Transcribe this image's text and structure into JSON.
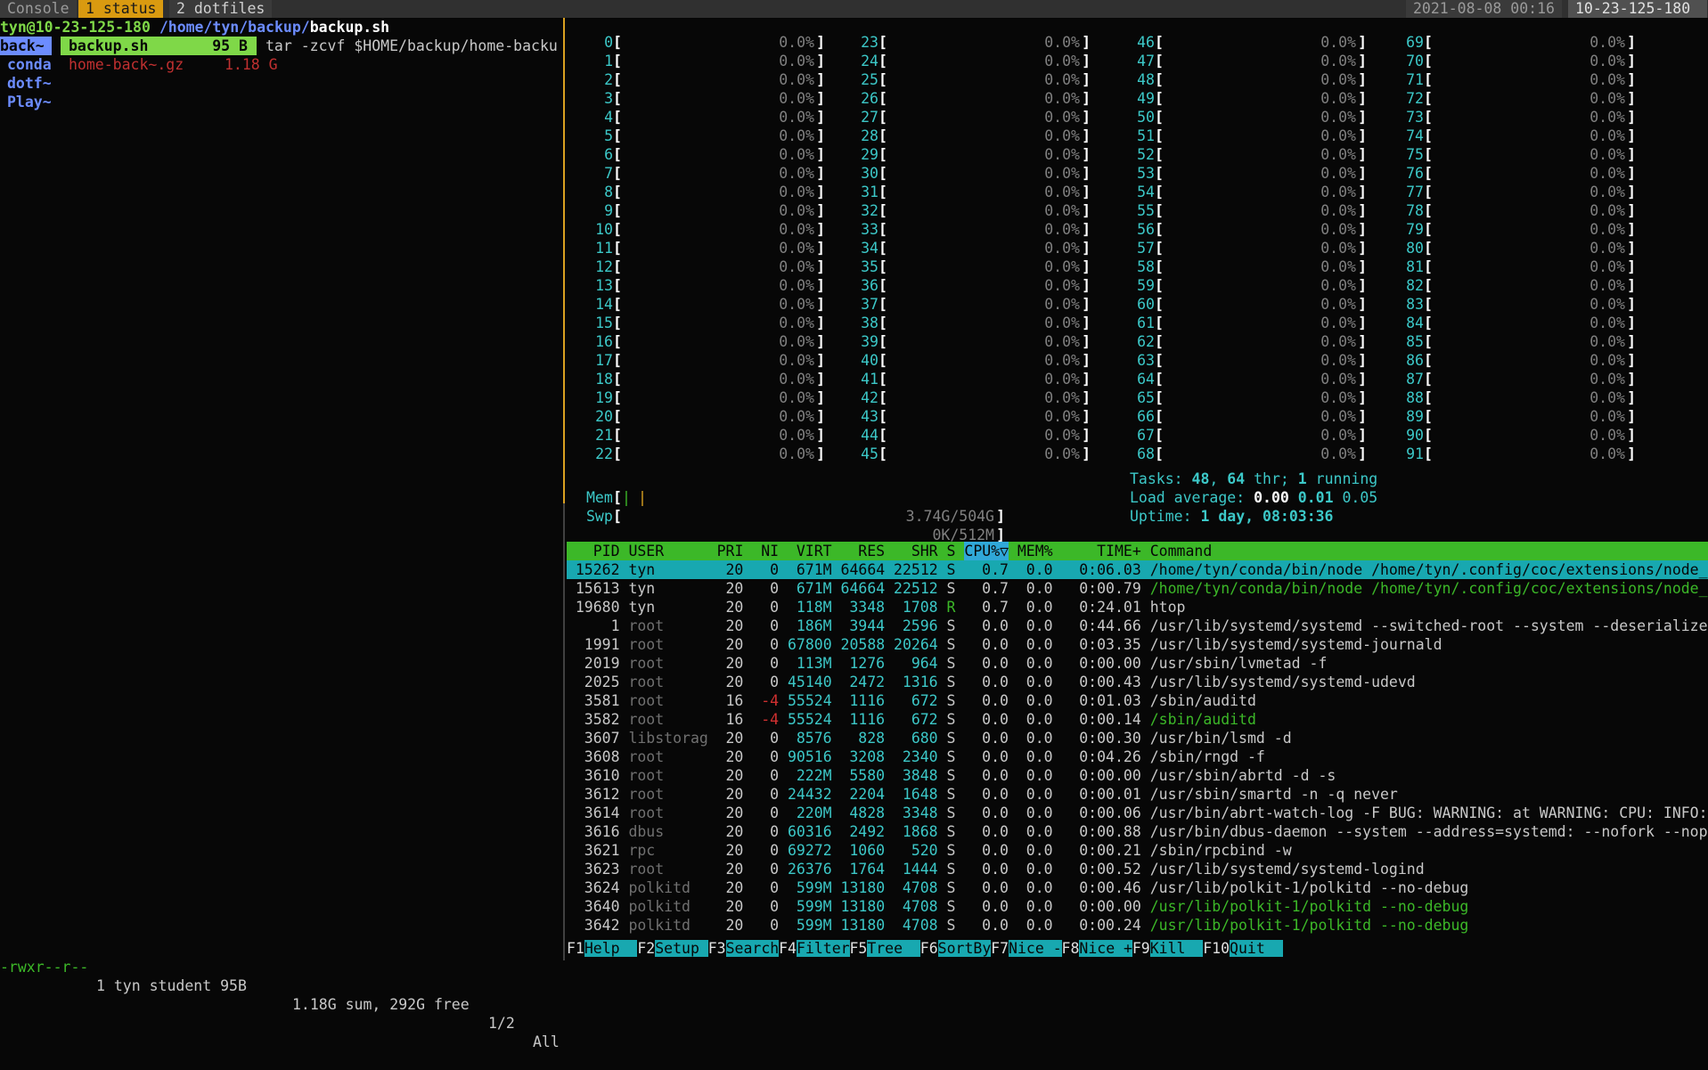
{
  "tmux": {
    "tabs": [
      "Console",
      "1 status",
      "2 dotfiles"
    ],
    "datetime": "2021-08-08 00:16",
    "host": "10-23-125-180"
  },
  "ranger": {
    "path_user": "tyn@10-23-125-180",
    "path_dir": " /home/tyn/backup/",
    "path_file": "backup.sh",
    "parent_entries": [
      "back~",
      "conda",
      "dotf~",
      "Play~"
    ],
    "current_file": "backup.sh",
    "current_size": "95 B",
    "current_extra_name": "home-back~.gz",
    "current_extra_size": "1.18 G",
    "preview": "tar -zcvf $HOME/backup/home-backu",
    "status_perm": "-rwxr--r--",
    "status_owner": "1 tyn student 95B",
    "status_sum": "1.18G sum, 292G free",
    "status_page": "1/2",
    "status_all": "All"
  },
  "htop": {
    "cpus": [
      [
        "0",
        "0.0%"
      ],
      [
        "1",
        "0.0%"
      ],
      [
        "2",
        "0.0%"
      ],
      [
        "3",
        "0.0%"
      ],
      [
        "4",
        "0.0%"
      ],
      [
        "5",
        "0.0%"
      ],
      [
        "6",
        "0.0%"
      ],
      [
        "7",
        "0.0%"
      ],
      [
        "8",
        "0.0%"
      ],
      [
        "9",
        "0.0%"
      ],
      [
        "10",
        "0.0%"
      ],
      [
        "11",
        "0.0%"
      ],
      [
        "12",
        "0.0%"
      ],
      [
        "13",
        "0.0%"
      ],
      [
        "14",
        "0.0%"
      ],
      [
        "15",
        "0.0%"
      ],
      [
        "16",
        "0.0%"
      ],
      [
        "17",
        "0.0%"
      ],
      [
        "18",
        "0.0%"
      ],
      [
        "19",
        "0.0%"
      ],
      [
        "20",
        "0.0%"
      ],
      [
        "21",
        "0.0%"
      ],
      [
        "22",
        "0.0%"
      ],
      [
        "23",
        "0.0%"
      ],
      [
        "24",
        "0.0%"
      ],
      [
        "25",
        "0.0%"
      ],
      [
        "26",
        "0.0%"
      ],
      [
        "27",
        "0.0%"
      ],
      [
        "28",
        "0.0%"
      ],
      [
        "29",
        "0.0%"
      ],
      [
        "30",
        "0.0%"
      ],
      [
        "31",
        "0.0%"
      ],
      [
        "32",
        "0.0%"
      ],
      [
        "33",
        "0.0%"
      ],
      [
        "34",
        "0.0%"
      ],
      [
        "35",
        "0.0%"
      ],
      [
        "36",
        "0.0%"
      ],
      [
        "37",
        "0.0%"
      ],
      [
        "38",
        "0.0%"
      ],
      [
        "39",
        "0.0%"
      ],
      [
        "40",
        "0.0%"
      ],
      [
        "41",
        "0.0%"
      ],
      [
        "42",
        "0.0%"
      ],
      [
        "43",
        "0.0%"
      ],
      [
        "44",
        "0.0%"
      ],
      [
        "45",
        "0.0%"
      ],
      [
        "46",
        "0.0%"
      ],
      [
        "47",
        "0.0%"
      ],
      [
        "48",
        "0.0%"
      ],
      [
        "49",
        "0.0%"
      ],
      [
        "50",
        "0.0%"
      ],
      [
        "51",
        "0.0%"
      ],
      [
        "52",
        "0.0%"
      ],
      [
        "53",
        "0.0%"
      ],
      [
        "54",
        "0.0%"
      ],
      [
        "55",
        "0.0%"
      ],
      [
        "56",
        "0.0%"
      ],
      [
        "57",
        "0.0%"
      ],
      [
        "58",
        "0.0%"
      ],
      [
        "59",
        "0.0%"
      ],
      [
        "60",
        "0.0%"
      ],
      [
        "61",
        "0.0%"
      ],
      [
        "62",
        "0.0%"
      ],
      [
        "63",
        "0.0%"
      ],
      [
        "64",
        "0.0%"
      ],
      [
        "65",
        "0.0%"
      ],
      [
        "66",
        "0.0%"
      ],
      [
        "67",
        "0.0%"
      ],
      [
        "68",
        "0.0%"
      ],
      [
        "69",
        "0.0%"
      ],
      [
        "70",
        "0.0%"
      ],
      [
        "71",
        "0.0%"
      ],
      [
        "72",
        "0.0%"
      ],
      [
        "73",
        "0.0%"
      ],
      [
        "74",
        "0.0%"
      ],
      [
        "75",
        "0.0%"
      ],
      [
        "76",
        "0.0%"
      ],
      [
        "77",
        "0.0%"
      ],
      [
        "78",
        "0.0%"
      ],
      [
        "79",
        "0.0%"
      ],
      [
        "80",
        "0.0%"
      ],
      [
        "81",
        "0.0%"
      ],
      [
        "82",
        "0.0%"
      ],
      [
        "83",
        "0.0%"
      ],
      [
        "84",
        "0.0%"
      ],
      [
        "85",
        "0.0%"
      ],
      [
        "86",
        "0.0%"
      ],
      [
        "87",
        "0.0%"
      ],
      [
        "88",
        "0.0%"
      ],
      [
        "89",
        "0.0%"
      ],
      [
        "90",
        "0.0%"
      ],
      [
        "91",
        "0.0%"
      ]
    ],
    "mem_label": "Mem",
    "mem_value": "3.74G/504G",
    "swp_label": "Swp",
    "swp_value": "0K/512M",
    "tasks_label": "Tasks: ",
    "tasks_count": "48",
    "tasks_sep1": ", ",
    "thr_count": "64",
    "thr_label": " thr; ",
    "running_count": "1",
    "running_label": " running",
    "load_label": "Load average: ",
    "load1": "0.00",
    "load5": "0.01",
    "load15": "0.05",
    "uptime_label": "Uptime: ",
    "uptime_value": "1 day, 08:03:36",
    "columns": [
      "PID",
      "USER",
      "PRI",
      "NI",
      "VIRT",
      "RES",
      "SHR",
      "S",
      "CPU%▽",
      "MEM%",
      "TIME+",
      "Command"
    ],
    "processes": [
      {
        "pid": "15262",
        "user": "tyn",
        "pri": "20",
        "ni": "0",
        "virt": "671M",
        "res": "64664",
        "shr": "22512",
        "s": "S",
        "cpu": "0.7",
        "mem": "0.0",
        "time": "0:06.03",
        "cmd": "/home/tyn/conda/bin/node /home/tyn/.config/coc/extensions/node_m"
      },
      {
        "pid": "15613",
        "user": "tyn",
        "pri": "20",
        "ni": "0",
        "virt": "671M",
        "res": "64664",
        "shr": "22512",
        "s": "S",
        "cpu": "0.7",
        "mem": "0.0",
        "time": "0:00.79",
        "cmd": "/home/tyn/conda/bin/node /home/tyn/.config/coc/extensions/node_m"
      },
      {
        "pid": "19680",
        "user": "tyn",
        "pri": "20",
        "ni": "0",
        "virt": "118M",
        "res": "3348",
        "shr": "1708",
        "s": "R",
        "cpu": "0.7",
        "mem": "0.0",
        "time": "0:24.01",
        "cmd": "htop"
      },
      {
        "pid": "1",
        "user": "root",
        "pri": "20",
        "ni": "0",
        "virt": "186M",
        "res": "3944",
        "shr": "2596",
        "s": "S",
        "cpu": "0.0",
        "mem": "0.0",
        "time": "0:44.66",
        "cmd": "/usr/lib/systemd/systemd --switched-root --system --deserialize"
      },
      {
        "pid": "1991",
        "user": "root",
        "pri": "20",
        "ni": "0",
        "virt": "67800",
        "res": "20588",
        "shr": "20264",
        "s": "S",
        "cpu": "0.0",
        "mem": "0.0",
        "time": "0:03.35",
        "cmd": "/usr/lib/systemd/systemd-journald"
      },
      {
        "pid": "2019",
        "user": "root",
        "pri": "20",
        "ni": "0",
        "virt": "113M",
        "res": "1276",
        "shr": "964",
        "s": "S",
        "cpu": "0.0",
        "mem": "0.0",
        "time": "0:00.00",
        "cmd": "/usr/sbin/lvmetad -f"
      },
      {
        "pid": "2025",
        "user": "root",
        "pri": "20",
        "ni": "0",
        "virt": "45140",
        "res": "2472",
        "shr": "1316",
        "s": "S",
        "cpu": "0.0",
        "mem": "0.0",
        "time": "0:00.43",
        "cmd": "/usr/lib/systemd/systemd-udevd"
      },
      {
        "pid": "3581",
        "user": "root",
        "pri": "16",
        "ni": "-4",
        "virt": "55524",
        "res": "1116",
        "shr": "672",
        "s": "S",
        "cpu": "0.0",
        "mem": "0.0",
        "time": "0:01.03",
        "cmd": "/sbin/auditd"
      },
      {
        "pid": "3582",
        "user": "root",
        "pri": "16",
        "ni": "-4",
        "virt": "55524",
        "res": "1116",
        "shr": "672",
        "s": "S",
        "cpu": "0.0",
        "mem": "0.0",
        "time": "0:00.14",
        "cmd": "/sbin/auditd"
      },
      {
        "pid": "3607",
        "user": "libstorag",
        "pri": "20",
        "ni": "0",
        "virt": "8576",
        "res": "828",
        "shr": "680",
        "s": "S",
        "cpu": "0.0",
        "mem": "0.0",
        "time": "0:00.30",
        "cmd": "/usr/bin/lsmd -d"
      },
      {
        "pid": "3608",
        "user": "root",
        "pri": "20",
        "ni": "0",
        "virt": "90516",
        "res": "3208",
        "shr": "2340",
        "s": "S",
        "cpu": "0.0",
        "mem": "0.0",
        "time": "0:04.26",
        "cmd": "/sbin/rngd -f"
      },
      {
        "pid": "3610",
        "user": "root",
        "pri": "20",
        "ni": "0",
        "virt": "222M",
        "res": "5580",
        "shr": "3848",
        "s": "S",
        "cpu": "0.0",
        "mem": "0.0",
        "time": "0:00.00",
        "cmd": "/usr/sbin/abrtd -d -s"
      },
      {
        "pid": "3612",
        "user": "root",
        "pri": "20",
        "ni": "0",
        "virt": "24432",
        "res": "2204",
        "shr": "1648",
        "s": "S",
        "cpu": "0.0",
        "mem": "0.0",
        "time": "0:00.01",
        "cmd": "/usr/sbin/smartd -n -q never"
      },
      {
        "pid": "3614",
        "user": "root",
        "pri": "20",
        "ni": "0",
        "virt": "220M",
        "res": "4828",
        "shr": "3348",
        "s": "S",
        "cpu": "0.0",
        "mem": "0.0",
        "time": "0:00.06",
        "cmd": "/usr/bin/abrt-watch-log -F BUG: WARNING: at WARNING: CPU: INFO:"
      },
      {
        "pid": "3616",
        "user": "dbus",
        "pri": "20",
        "ni": "0",
        "virt": "60316",
        "res": "2492",
        "shr": "1868",
        "s": "S",
        "cpu": "0.0",
        "mem": "0.0",
        "time": "0:00.88",
        "cmd": "/usr/bin/dbus-daemon --system --address=systemd: --nofork --nopi"
      },
      {
        "pid": "3621",
        "user": "rpc",
        "pri": "20",
        "ni": "0",
        "virt": "69272",
        "res": "1060",
        "shr": "520",
        "s": "S",
        "cpu": "0.0",
        "mem": "0.0",
        "time": "0:00.21",
        "cmd": "/sbin/rpcbind -w"
      },
      {
        "pid": "3623",
        "user": "root",
        "pri": "20",
        "ni": "0",
        "virt": "26376",
        "res": "1764",
        "shr": "1444",
        "s": "S",
        "cpu": "0.0",
        "mem": "0.0",
        "time": "0:00.52",
        "cmd": "/usr/lib/systemd/systemd-logind"
      },
      {
        "pid": "3624",
        "user": "polkitd",
        "pri": "20",
        "ni": "0",
        "virt": "599M",
        "res": "13180",
        "shr": "4708",
        "s": "S",
        "cpu": "0.0",
        "mem": "0.0",
        "time": "0:00.46",
        "cmd": "/usr/lib/polkit-1/polkitd --no-debug"
      },
      {
        "pid": "3640",
        "user": "polkitd",
        "pri": "20",
        "ni": "0",
        "virt": "599M",
        "res": "13180",
        "shr": "4708",
        "s": "S",
        "cpu": "0.0",
        "mem": "0.0",
        "time": "0:00.00",
        "cmd": "/usr/lib/polkit-1/polkitd --no-debug"
      },
      {
        "pid": "3642",
        "user": "polkitd",
        "pri": "20",
        "ni": "0",
        "virt": "599M",
        "res": "13180",
        "shr": "4708",
        "s": "S",
        "cpu": "0.0",
        "mem": "0.0",
        "time": "0:00.24",
        "cmd": "/usr/lib/polkit-1/polkitd --no-debug"
      }
    ],
    "fn_keys": [
      [
        "F1",
        "Help  "
      ],
      [
        "F2",
        "Setup "
      ],
      [
        "F3",
        "Search"
      ],
      [
        "F4",
        "Filter"
      ],
      [
        "F5",
        "Tree  "
      ],
      [
        "F6",
        "SortBy"
      ],
      [
        "F7",
        "Nice -"
      ],
      [
        "F8",
        "Nice +"
      ],
      [
        "F9",
        "Kill  "
      ],
      [
        "F10",
        "Quit  "
      ]
    ]
  },
  "colors": {
    "accent_green": "#3cb828",
    "accent_cyan": "#18a8b0",
    "tmux_active": "#d99a10",
    "ranger_dir": "#6c8cff"
  }
}
